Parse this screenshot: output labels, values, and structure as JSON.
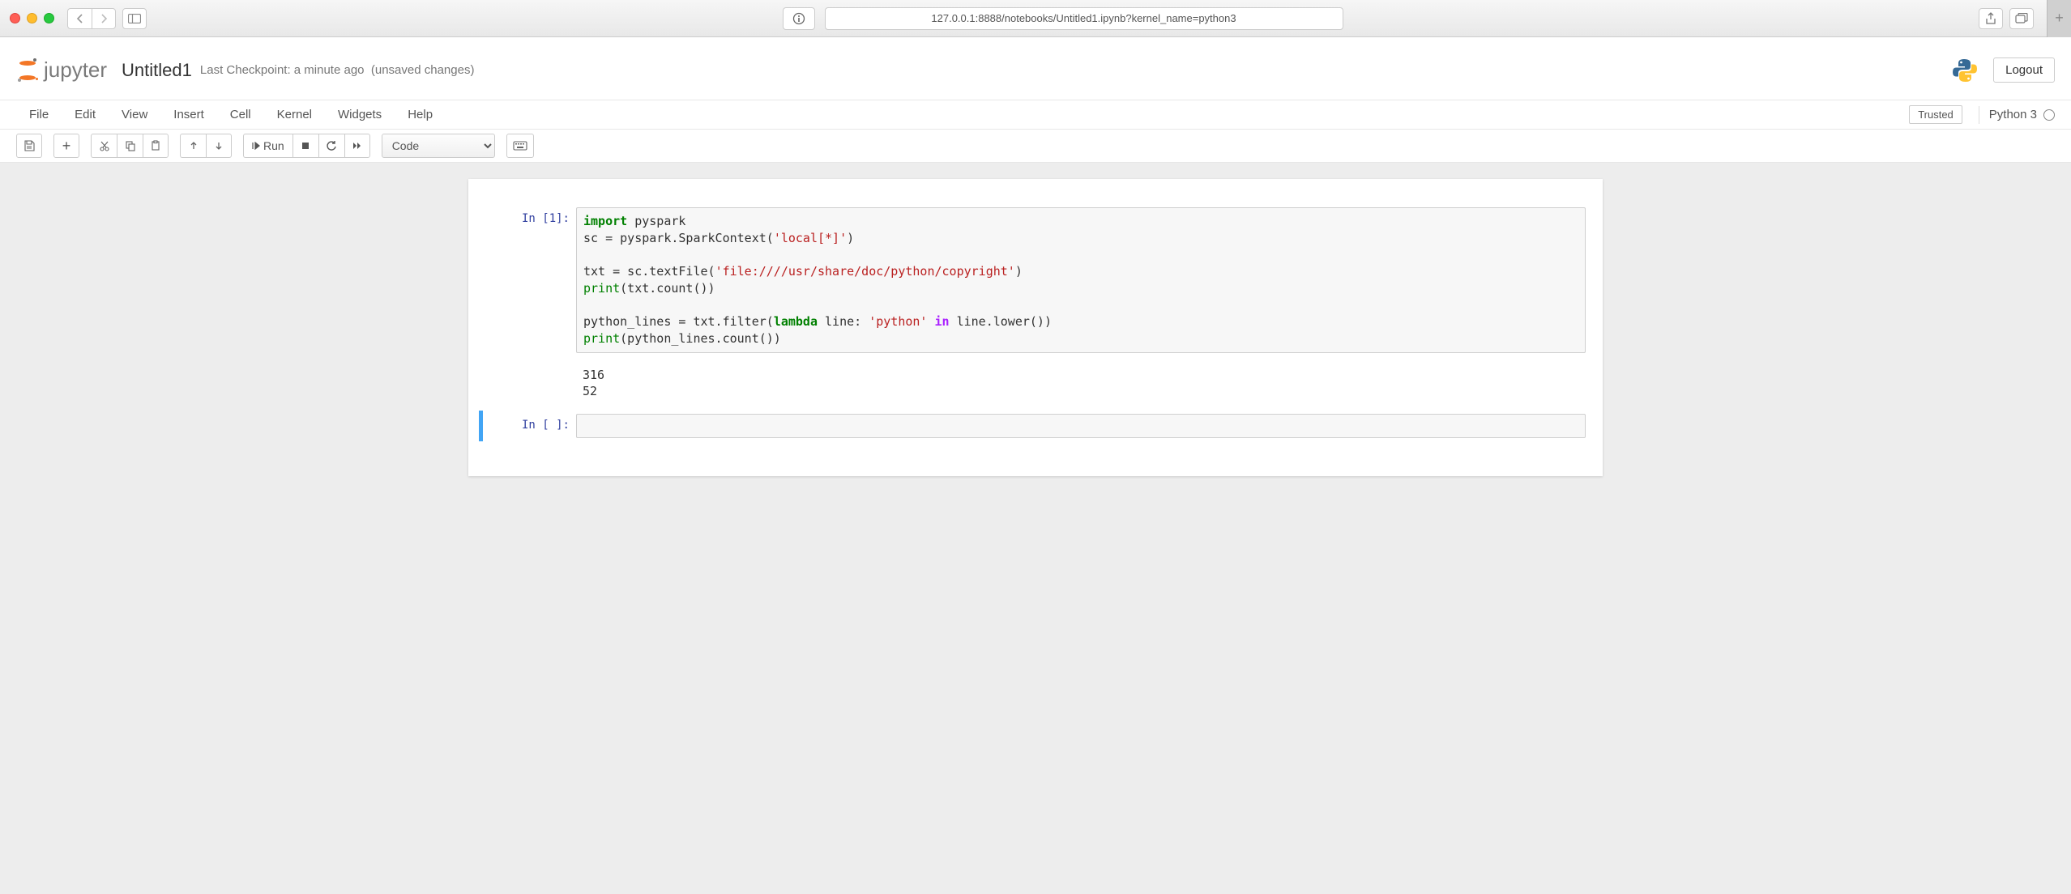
{
  "browser": {
    "url": "127.0.0.1:8888/notebooks/Untitled1.ipynb?kernel_name=python3"
  },
  "header": {
    "logo_text": "jupyter",
    "title": "Untitled1",
    "checkpoint": "Last Checkpoint: a minute ago",
    "unsaved": "(unsaved changes)",
    "logout": "Logout"
  },
  "menu": {
    "items": [
      "File",
      "Edit",
      "View",
      "Insert",
      "Cell",
      "Kernel",
      "Widgets",
      "Help"
    ],
    "trusted": "Trusted",
    "kernel": "Python 3"
  },
  "toolbar": {
    "run_label": "Run",
    "cell_type": "Code"
  },
  "cells": [
    {
      "prompt": "In [1]:",
      "code_tokens": [
        {
          "t": "import",
          "c": "k"
        },
        {
          "t": " pyspark\n"
        },
        {
          "t": "sc "
        },
        {
          "t": "=",
          "c": ""
        },
        {
          "t": " pyspark.SparkContext("
        },
        {
          "t": "'local[*]'",
          "c": "s"
        },
        {
          "t": ")\n"
        },
        {
          "t": "\n"
        },
        {
          "t": "txt "
        },
        {
          "t": "=",
          "c": ""
        },
        {
          "t": " sc.textFile("
        },
        {
          "t": "'file:////usr/share/doc/python/copyright'",
          "c": "s"
        },
        {
          "t": ")\n"
        },
        {
          "t": "print",
          "c": "nb"
        },
        {
          "t": "(txt.count())\n"
        },
        {
          "t": "\n"
        },
        {
          "t": "python_lines "
        },
        {
          "t": "=",
          "c": ""
        },
        {
          "t": " txt.filter("
        },
        {
          "t": "lambda",
          "c": "k"
        },
        {
          "t": " line: "
        },
        {
          "t": "'python'",
          "c": "s"
        },
        {
          "t": " "
        },
        {
          "t": "in",
          "c": "ow"
        },
        {
          "t": " line.lower())\n"
        },
        {
          "t": "print",
          "c": "nb"
        },
        {
          "t": "(python_lines.count())"
        }
      ],
      "output": "316\n52"
    },
    {
      "prompt": "In [ ]:",
      "code_tokens": [],
      "output": null,
      "active": true
    }
  ]
}
